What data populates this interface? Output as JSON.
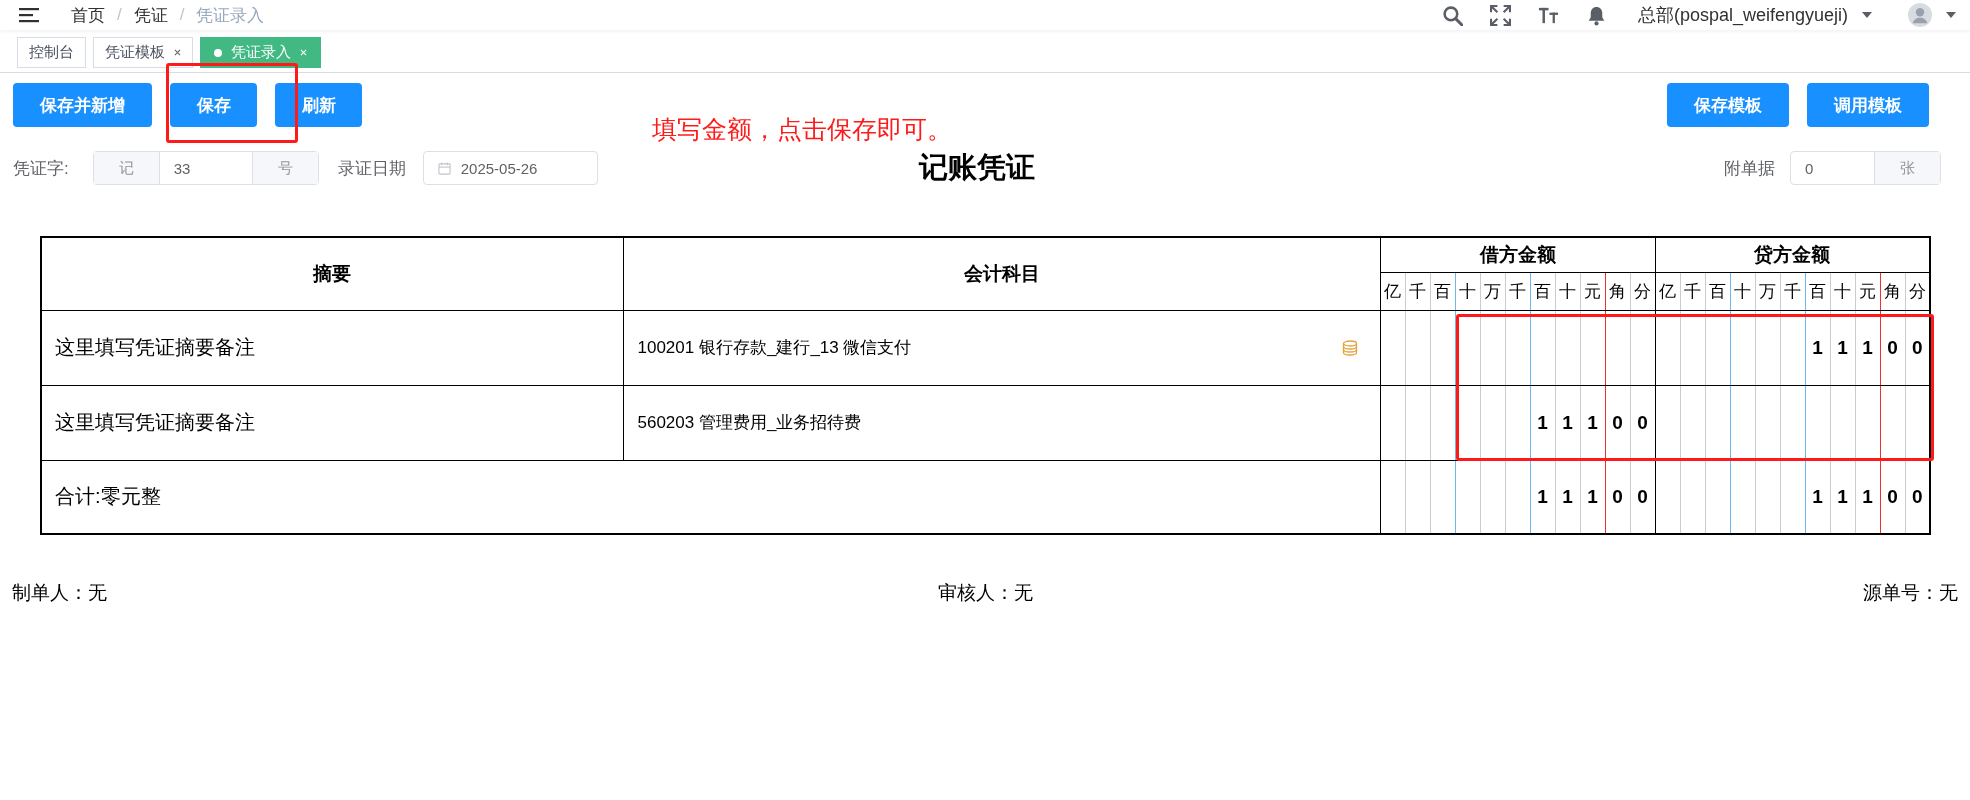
{
  "header": {
    "breadcrumb": [
      {
        "kind": "item",
        "label": "首页",
        "current": false
      },
      {
        "kind": "separator",
        "label": "/"
      },
      {
        "kind": "item",
        "label": "凭证",
        "current": false
      },
      {
        "kind": "separator",
        "label": "/"
      },
      {
        "kind": "item",
        "label": "凭证录入",
        "current": true
      }
    ],
    "user": "总部(pospal_weifengyueji)"
  },
  "tabs": [
    {
      "label": "控制台",
      "selected": false,
      "closable": false
    },
    {
      "label": "凭证模板",
      "selected": false,
      "closable": true
    },
    {
      "label": "凭证录入",
      "selected": true,
      "closable": true
    }
  ],
  "toolbar": {
    "left_buttons": [
      "保存并新增",
      "保存",
      "刷新"
    ],
    "right_buttons": [
      "保存模板",
      "调用模板"
    ]
  },
  "annotation": {
    "note": "填写金额，点击保存即可。"
  },
  "voucher": {
    "word_label": "凭证字:",
    "word_prefix": "记",
    "number": "33",
    "number_suffix": "号",
    "date_label": "录证日期",
    "date": "2025-05-26",
    "title": "记账凭证",
    "attachments_label": "附单据",
    "attachments": "0",
    "attachments_suffix": "张"
  },
  "table": {
    "columns": {
      "summary": "摘要",
      "subject": "会计科目",
      "debit": "借方金额",
      "credit": "贷方金额"
    },
    "debit_units": [
      "亿",
      "千",
      "百",
      "十",
      "万",
      "千",
      "百",
      "十",
      "元",
      "角",
      "分"
    ],
    "credit_units": [
      "亿",
      "千",
      "百",
      "十",
      "万",
      "千",
      "百",
      "十",
      "元",
      "角",
      "分"
    ],
    "rows": [
      {
        "summary": "这里填写凭证摘要备注",
        "subject": "100201 银行存款_建行_13 微信支付",
        "balance_icon": true,
        "credit": [
          "1",
          "1",
          "1",
          "0",
          "0"
        ]
      },
      {
        "summary": "这里填写凭证摘要备注",
        "subject": "560203 管理费用_业务招待费",
        "balance_icon": false,
        "debit": [
          "1",
          "1",
          "1",
          "0",
          "0"
        ]
      }
    ],
    "total": {
      "label": "合计:零元整",
      "debit": [
        "1",
        "1",
        "1",
        "0",
        "0"
      ],
      "credit": [
        "1",
        "1",
        "1",
        "0",
        "0"
      ]
    }
  },
  "footer": [
    "制单人：无",
    "审核人：无",
    "源单号：无"
  ]
}
